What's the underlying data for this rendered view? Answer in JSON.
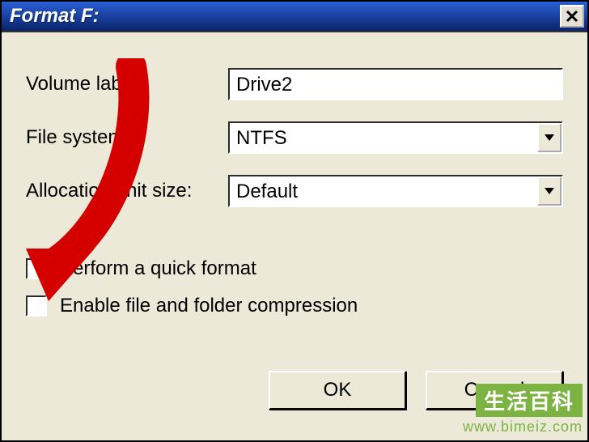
{
  "window": {
    "title": "Format F:"
  },
  "fields": {
    "volume_label_label": "Volume label:",
    "volume_label_value": "Drive2",
    "file_system_label": "File system:",
    "file_system_value": "NTFS",
    "allocation_label": "Allocation unit size:",
    "allocation_value": "Default"
  },
  "checkboxes": {
    "quick_format_label": "Perform a quick format",
    "quick_format_checked": false,
    "compression_label": "Enable file and folder compression",
    "compression_checked": false
  },
  "buttons": {
    "ok": "OK",
    "cancel": "Cancel"
  },
  "watermark": {
    "line1": "生活百科",
    "line2": "www.bimeiz.com"
  }
}
